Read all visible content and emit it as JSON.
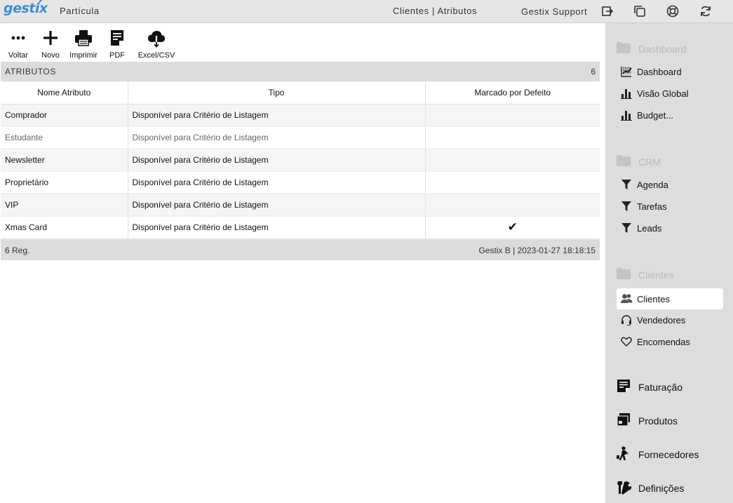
{
  "header": {
    "logo": "gestix",
    "company": "Partícula",
    "breadcrumb": "Clientes | Atributos",
    "user": "Gestix Support",
    "icons": [
      "logout-icon",
      "windows-icon",
      "support-icon",
      "refresh-icon"
    ]
  },
  "toolbar": {
    "back": "Voltar",
    "new": "Novo",
    "print": "Imprimir",
    "pdf": "PDF",
    "excel": "Excel/CSV"
  },
  "panel": {
    "title": "ATRIBUTOS",
    "count": "6",
    "columns": [
      "Nome Atributo",
      "Tipo",
      "Marcado por Defeito"
    ],
    "rows": [
      {
        "name": "Comprador",
        "type": "Disponível para Critério de Listagem",
        "default": ""
      },
      {
        "name": "Estudante",
        "type": "Disponível para Critério de Listagem",
        "default": ""
      },
      {
        "name": "Newsletter",
        "type": "Disponível para Critério de Listagem",
        "default": ""
      },
      {
        "name": "Proprietário",
        "type": "Disponível para Critério de Listagem",
        "default": ""
      },
      {
        "name": "VIP",
        "type": "Disponível para Critério de Listagem",
        "default": ""
      },
      {
        "name": "Xmas Card",
        "type": "Disponível para Critério de Listagem",
        "default": "✔"
      }
    ],
    "footer_left": "6 Reg.",
    "footer_right": "Gestix B | 2023-01-27 18:18:15"
  },
  "sidebar": {
    "sections": [
      {
        "title": "Dashboard",
        "items": [
          "Dashboard",
          "Visão Global",
          "Budget..."
        ]
      },
      {
        "title": "CRM",
        "items": [
          "Agenda",
          "Tarefas",
          "Leads"
        ]
      },
      {
        "title": "Clientes",
        "items": [
          "Clientes",
          "Vendedores",
          "Encomendas"
        ],
        "active": "Clientes"
      }
    ],
    "modules": [
      "Faturação",
      "Produtos",
      "Fornecedores",
      "Definições"
    ]
  },
  "colors": {
    "brand": "#3d8fcf",
    "topbar": "#e6e6e6",
    "sidebar": "#dddddd",
    "panel_header": "#dcdcdc"
  }
}
